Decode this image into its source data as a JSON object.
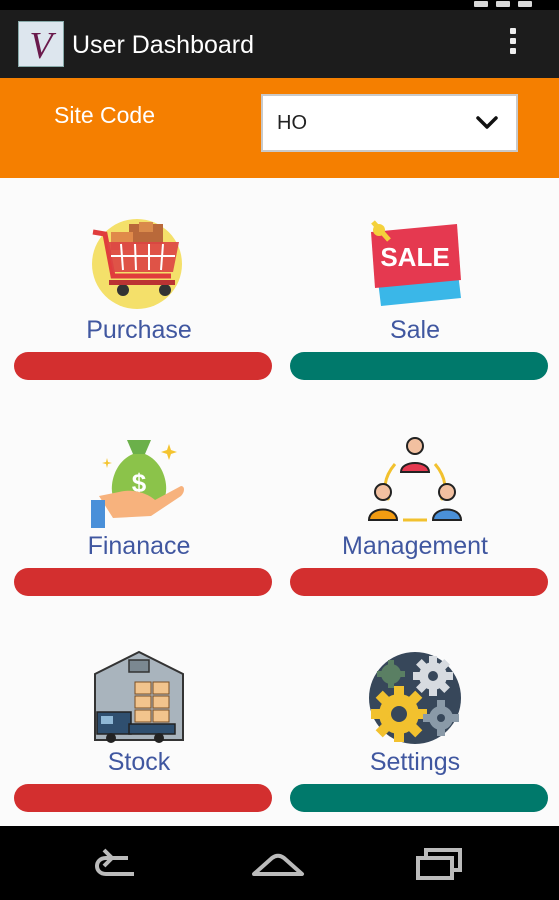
{
  "app": {
    "title": "User Dashboard",
    "logo_letter": "V"
  },
  "site": {
    "label": "Site Code",
    "selected": "HO"
  },
  "tiles": [
    {
      "label": "Purchase",
      "icon": "shopping-cart-icon",
      "bar_color": "#d32f2f"
    },
    {
      "label": "Sale",
      "icon": "sale-tag-icon",
      "bar_color": "#00796b"
    },
    {
      "label": "Finanace",
      "icon": "money-bag-hand-icon",
      "bar_color": "#d32f2f"
    },
    {
      "label": "Management",
      "icon": "team-cycle-icon",
      "bar_color": "#d32f2f"
    },
    {
      "label": "Stock",
      "icon": "warehouse-truck-icon",
      "bar_color": "#d32f2f"
    },
    {
      "label": "Settings",
      "icon": "gears-icon",
      "bar_color": "#00796b"
    }
  ],
  "colors": {
    "accent": "#f57f00",
    "toolbar": "#1c1c1c",
    "red_bar": "#d32f2f",
    "green_bar": "#00796b",
    "label": "#4057a0"
  },
  "nav": [
    "back-icon",
    "home-icon",
    "recents-icon"
  ]
}
